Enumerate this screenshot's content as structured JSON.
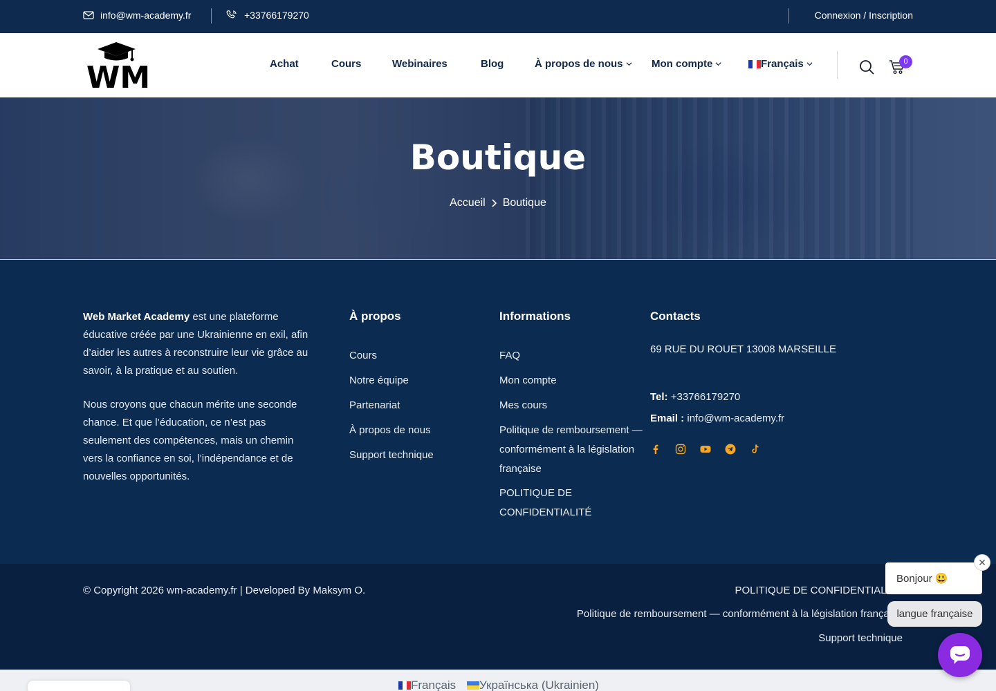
{
  "topbar": {
    "email": "info@wm-academy.fr",
    "phone": "+33766179270",
    "login": "Connexion / Inscription"
  },
  "header": {
    "logo_text": "WM",
    "nav": [
      "Achat",
      "Cours",
      "Webinaires",
      "Blog",
      "À propos de nous",
      "Mon compte"
    ],
    "language": "Français",
    "cart_count": "0"
  },
  "hero": {
    "title": "Boutique",
    "breadcrumb": [
      "Accueil",
      "Boutique"
    ]
  },
  "footer": {
    "about_brand": "Web Market Academy",
    "about_p1_rest": " est une plateforme éducative créée par une Ukrainienne en exil, afin d’aider les autres à reconstruire leur vie grâce au savoir, à la pratique et au soutien.",
    "about_p2": "Nous croyons que chacun mérite une seconde chance. Et que l’éducation, ce n’est pas seulement des compétences, mais un chemin vers la confiance en soi, l’indépendance et de nouvelles opportunités.",
    "col_apropos": {
      "title": "À propos",
      "links": [
        "Cours",
        "Notre équipe",
        "Partenariat",
        "À propos de nous",
        "Support technique"
      ]
    },
    "col_info": {
      "title": "Informations",
      "links": [
        "FAQ",
        "Mon compte",
        "Mes cours",
        "Politique de remboursement — conformément à la législation française",
        "POLITIQUE DE CONFIDENTIALITÉ"
      ]
    },
    "col_contacts": {
      "title": "Contacts",
      "address": "69 RUE DU ROUET 13008 MARSEILLE",
      "tel_label": "Tel:",
      "tel": "+33766179270",
      "email_label": "Email :",
      "email": "info@wm-academy.fr"
    },
    "socials": [
      "facebook-icon",
      "instagram-icon",
      "youtube-icon",
      "telegram-icon",
      "tiktok-icon"
    ],
    "social_color": "#f5a623"
  },
  "bottom": {
    "copyright": "© Copyright 2026 wm-academy.fr | Developed By Maksym O.",
    "links": [
      "POLITIQUE DE CONFIDENTIALITÉ",
      "Politique de remboursement — conformément à la législation française",
      "Support technique"
    ]
  },
  "langbar": {
    "fr": "Français",
    "ua": "Українська (Ukrainien)"
  },
  "chat": {
    "greeting": "Bonjour 😃",
    "lang": "langue française",
    "close": "✕",
    "accent": "#8a2be2"
  }
}
